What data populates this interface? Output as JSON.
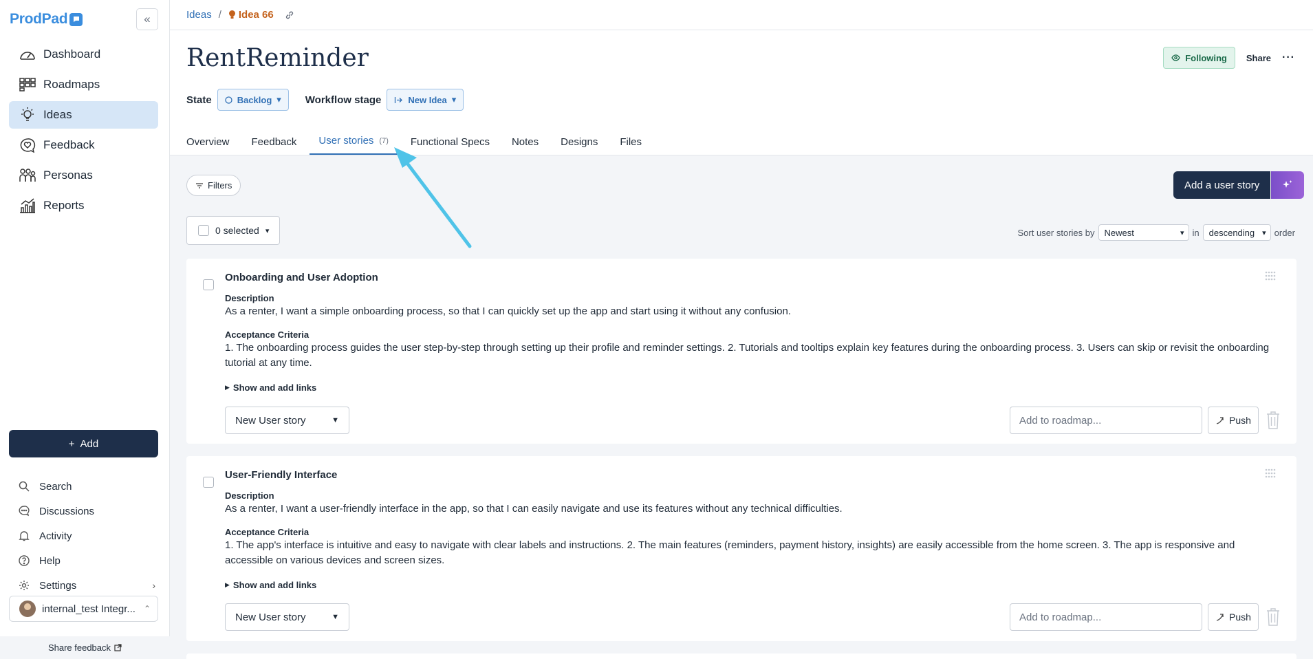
{
  "brand": {
    "name": "ProdPad",
    "accent": "#3a8dde"
  },
  "sidebar": {
    "items": [
      {
        "label": "Dashboard",
        "icon": "gauge-icon"
      },
      {
        "label": "Roadmaps",
        "icon": "roadmap-grid-icon"
      },
      {
        "label": "Ideas",
        "icon": "lightbulb-icon",
        "active": true
      },
      {
        "label": "Feedback",
        "icon": "heart-chat-icon"
      },
      {
        "label": "Personas",
        "icon": "people-icon"
      },
      {
        "label": "Reports",
        "icon": "bar-chart-icon"
      }
    ],
    "add_label": "Add",
    "bottom": [
      {
        "label": "Search",
        "icon": "search-icon"
      },
      {
        "label": "Discussions",
        "icon": "chat-icon"
      },
      {
        "label": "Activity",
        "icon": "bell-icon"
      },
      {
        "label": "Help",
        "icon": "help-icon"
      },
      {
        "label": "Settings",
        "icon": "gear-icon"
      }
    ],
    "user": "internal_test Integr...",
    "share_feedback": "Share feedback"
  },
  "breadcrumb": {
    "root": "Ideas",
    "sep": "/",
    "current": "Idea 66"
  },
  "idea": {
    "title": "RentReminder",
    "following": "Following",
    "share": "Share",
    "more": "···",
    "state_label": "State",
    "state_value": "Backlog",
    "workflow_label": "Workflow stage",
    "workflow_value": "New Idea"
  },
  "tabs": [
    {
      "label": "Overview"
    },
    {
      "label": "Feedback"
    },
    {
      "label": "User stories",
      "count": "(7)",
      "active": true
    },
    {
      "label": "Functional Specs"
    },
    {
      "label": "Notes"
    },
    {
      "label": "Designs"
    },
    {
      "label": "Files"
    }
  ],
  "toolbar": {
    "filters": "Filters",
    "add_story": "Add a user story",
    "selected": "0 selected",
    "sort_prefix": "Sort user stories by",
    "sort_value": "Newest",
    "in": "in",
    "order_value": "descending",
    "order_suffix": "order"
  },
  "stories": [
    {
      "title": "Onboarding and User Adoption",
      "description_label": "Description",
      "description": "As a renter, I want a simple onboarding process, so that I can quickly set up the app and start using it without any confusion.",
      "criteria_label": "Acceptance Criteria",
      "criteria": "1. The onboarding process guides the user step-by-step through setting up their profile and reminder settings. 2. Tutorials and tooltips explain key features during the onboarding process. 3. Users can skip or revisit the onboarding tutorial at any time.",
      "links": "Show and add links",
      "stage": "New User story",
      "roadmap_placeholder": "Add to roadmap...",
      "push": "Push"
    },
    {
      "title": "User-Friendly Interface",
      "description_label": "Description",
      "description": "As a renter, I want a user-friendly interface in the app, so that I can easily navigate and use its features without any technical difficulties.",
      "criteria_label": "Acceptance Criteria",
      "criteria": "1. The app's interface is intuitive and easy to navigate with clear labels and instructions. 2. The main features (reminders, payment history, insights) are easily accessible from the home screen. 3. The app is responsive and accessible on various devices and screen sizes.",
      "links": "Show and add links",
      "stage": "New User story",
      "roadmap_placeholder": "Add to roadmap...",
      "push": "Push"
    }
  ],
  "annotation_arrow_color": "#4fc3e8"
}
